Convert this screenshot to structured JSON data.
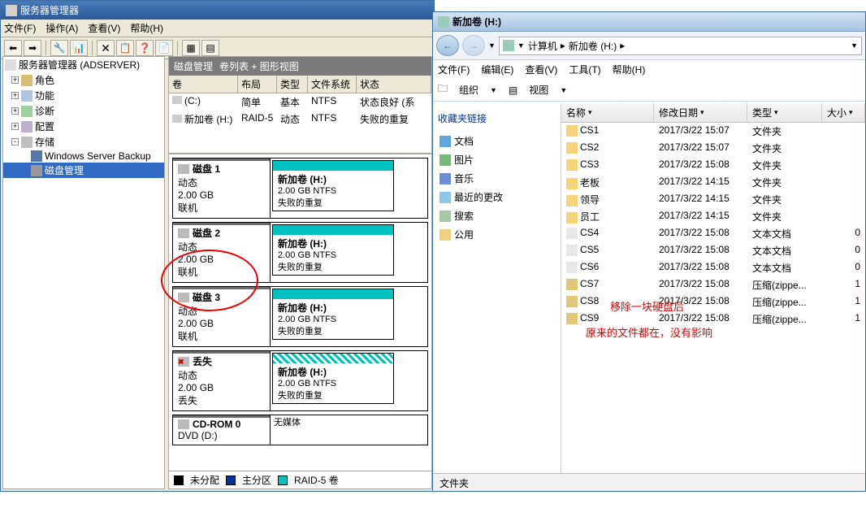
{
  "server_mgr": {
    "title": "服务器管理器",
    "menu": {
      "file": "文件(F)",
      "action": "操作(A)",
      "view": "查看(V)",
      "help": "帮助(H)"
    },
    "tree": {
      "root": "服务器管理器 (ADSERVER)",
      "roles": "角色",
      "features": "功能",
      "diag": "诊断",
      "config": "配置",
      "storage": "存储",
      "backup": "Windows Server Backup",
      "diskmgmt": "磁盘管理"
    },
    "dm": {
      "header_label": "磁盘管理",
      "view_label": "卷列表 + 图形视图",
      "cols": {
        "vol": "卷",
        "layout": "布局",
        "type": "类型",
        "fs": "文件系统",
        "status": "状态"
      },
      "rows": [
        {
          "vol": "(C:)",
          "layout": "简单",
          "type": "基本",
          "fs": "NTFS",
          "status": "状态良好 (系"
        },
        {
          "vol": "新加卷 (H:)",
          "layout": "RAID-5",
          "type": "动态",
          "fs": "NTFS",
          "status": "失败的重复"
        }
      ],
      "disks": [
        {
          "name": "磁盘 1",
          "type": "动态",
          "size": "2.00 GB",
          "state": "联机",
          "vol_name": "新加卷 (H:)",
          "vol_size": "2.00 GB NTFS",
          "vol_status": "失败的重复",
          "hatched": false,
          "missing": false
        },
        {
          "name": "磁盘 2",
          "type": "动态",
          "size": "2.00 GB",
          "state": "联机",
          "vol_name": "新加卷 (H:)",
          "vol_size": "2.00 GB NTFS",
          "vol_status": "失败的重复",
          "hatched": false,
          "missing": false
        },
        {
          "name": "磁盘 3",
          "type": "动态",
          "size": "2.00 GB",
          "state": "联机",
          "vol_name": "新加卷 (H:)",
          "vol_size": "2.00 GB NTFS",
          "vol_status": "失败的重复",
          "hatched": false,
          "missing": false
        },
        {
          "name": "丢失",
          "type": "动态",
          "size": "2.00 GB",
          "state": "丢失",
          "vol_name": "新加卷 (H:)",
          "vol_size": "2.00 GB NTFS",
          "vol_status": "失败的重复",
          "hatched": true,
          "missing": true
        }
      ],
      "cdrom": {
        "name": "CD-ROM 0",
        "line2": "DVD (D:)",
        "nomedia": "无媒体"
      },
      "legend": {
        "unalloc": "未分配",
        "primary": "主分区",
        "raid5": "RAID-5 卷"
      }
    }
  },
  "explorer": {
    "title": "新加卷 (H:)",
    "breadcrumb1": "计算机",
    "breadcrumb2": "新加卷 (H:)",
    "menu": {
      "file": "文件(F)",
      "edit": "编辑(E)",
      "view": "查看(V)",
      "tools": "工具(T)",
      "help": "帮助(H)"
    },
    "toolbar": {
      "organize": "组织",
      "views": "视图"
    },
    "fav": {
      "title": "收藏夹链接",
      "docs": "文档",
      "pics": "图片",
      "music": "音乐",
      "recent": "最近的更改",
      "search": "搜索",
      "public": "公用"
    },
    "cols": {
      "name": "名称",
      "date": "修改日期",
      "type": "类型",
      "size": "大小"
    },
    "files": [
      {
        "ico": "fld",
        "name": "CS1",
        "date": "2017/3/22 15:07",
        "type": "文件夹",
        "size": ""
      },
      {
        "ico": "fld",
        "name": "CS2",
        "date": "2017/3/22 15:07",
        "type": "文件夹",
        "size": ""
      },
      {
        "ico": "fld",
        "name": "CS3",
        "date": "2017/3/22 15:08",
        "type": "文件夹",
        "size": ""
      },
      {
        "ico": "fld",
        "name": "老板",
        "date": "2017/3/22 14:15",
        "type": "文件夹",
        "size": ""
      },
      {
        "ico": "fld",
        "name": "领导",
        "date": "2017/3/22 14:15",
        "type": "文件夹",
        "size": ""
      },
      {
        "ico": "fld",
        "name": "员工",
        "date": "2017/3/22 14:15",
        "type": "文件夹",
        "size": ""
      },
      {
        "ico": "txt",
        "name": "CS4",
        "date": "2017/3/22 15:08",
        "type": "文本文档",
        "size": "0"
      },
      {
        "ico": "txt",
        "name": "CS5",
        "date": "2017/3/22 15:08",
        "type": "文本文档",
        "size": "0"
      },
      {
        "ico": "txt",
        "name": "CS6",
        "date": "2017/3/22 15:08",
        "type": "文本文档",
        "size": "0"
      },
      {
        "ico": "zip",
        "name": "CS7",
        "date": "2017/3/22 15:08",
        "type": "压缩(zippe...",
        "size": "1"
      },
      {
        "ico": "zip",
        "name": "CS8",
        "date": "2017/3/22 15:08",
        "type": "压缩(zippe...",
        "size": "1"
      },
      {
        "ico": "zip",
        "name": "CS9",
        "date": "2017/3/22 15:08",
        "type": "压缩(zippe...",
        "size": "1"
      }
    ],
    "status": "文件夹",
    "ann1": "移除一块硬盘后",
    "ann2": "原来的文件都在，没有影响"
  }
}
